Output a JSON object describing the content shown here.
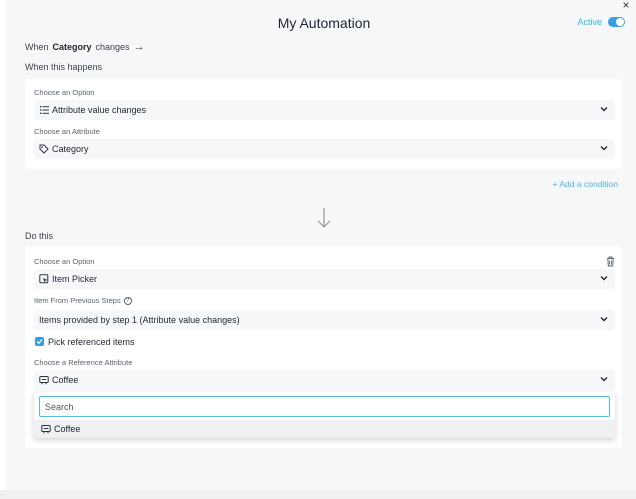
{
  "header": {
    "title": "My Automation",
    "active_label": "Active",
    "toggle_on": true,
    "accent_color": "#3bb3d6"
  },
  "trigger_summary": {
    "prefix": "When",
    "attribute": "Category",
    "suffix": "changes",
    "arrow": "→"
  },
  "when_section": {
    "heading": "When this happens",
    "option_label": "Choose an Option",
    "option_value": "Attribute value changes",
    "option_icon": "list-icon",
    "attribute_label": "Choose an Attribute",
    "attribute_value": "Category",
    "attribute_icon": "tag-icon",
    "add_condition": "+ Add a condition"
  },
  "do_section": {
    "heading": "Do this",
    "option_label": "Choose an Option",
    "option_value": "Item Picker",
    "option_icon": "item-picker-icon",
    "items_label": "Item From Previous Steps",
    "items_value": "Items provided by step 1 (Attribute value changes)",
    "pick_referenced_label": "Pick referenced items",
    "pick_referenced_checked": true,
    "reference_label": "Choose a Reference Attribute",
    "reference_value": "Coffee",
    "reference_icon": "reference-icon"
  },
  "dropdown": {
    "search_placeholder": "Search",
    "options": [
      "Coffee"
    ]
  },
  "colors": {
    "panel_bg": "#f6f7f9",
    "toggle": "#3b9ee0",
    "checkbox": "#2f9fe0",
    "link": "#4bb4dc"
  }
}
